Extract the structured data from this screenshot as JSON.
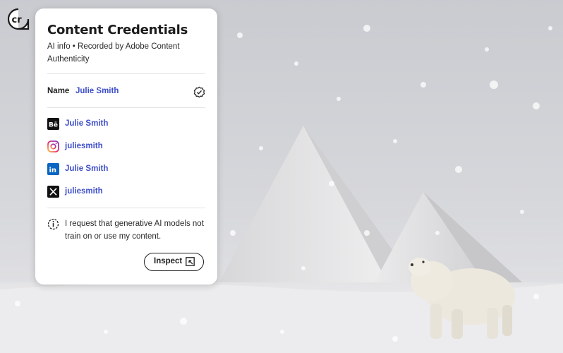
{
  "card": {
    "title": "Content Credentials",
    "subtitle": "AI info • Recorded by Adobe Content Authenticity",
    "name_label": "Name",
    "name_value": "Julie Smith",
    "socials": [
      {
        "icon": "behance-icon",
        "label": "Julie Smith"
      },
      {
        "icon": "instagram-icon",
        "label": "juliesmith"
      },
      {
        "icon": "linkedin-icon",
        "label": "Julie Smith"
      },
      {
        "icon": "x-icon",
        "label": "juliesmith"
      }
    ],
    "ai_notice": "I request that generative AI models not train on or use my content.",
    "inspect_label": "Inspect"
  },
  "badge": {
    "text": "cr"
  },
  "colors": {
    "link": "#3d4ec8",
    "card_bg": "#ffffff"
  }
}
